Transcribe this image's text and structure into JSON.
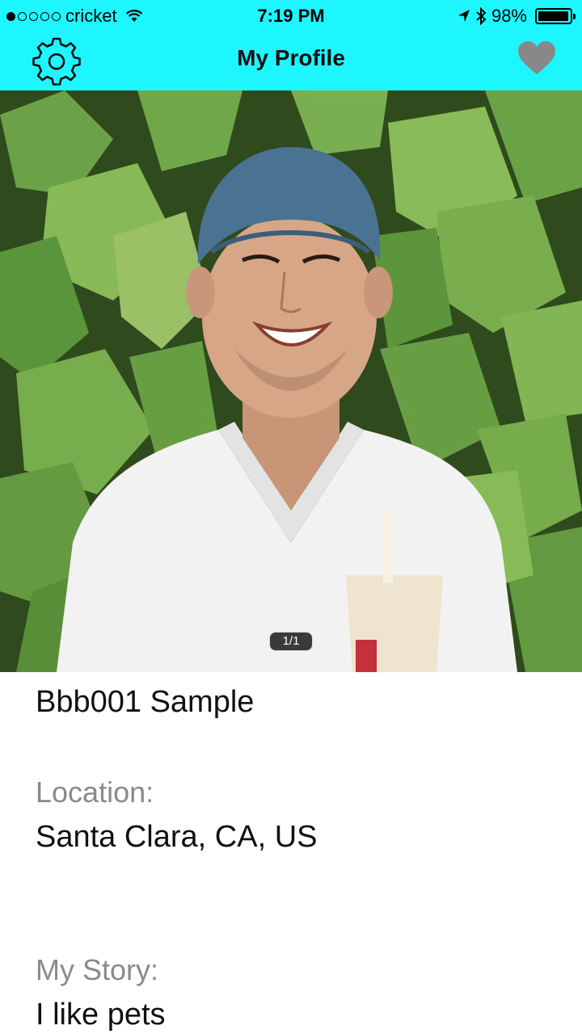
{
  "status_bar": {
    "carrier": "cricket",
    "time": "7:19 PM",
    "battery_percent": "98%",
    "battery_level": 0.98,
    "icons": [
      "signal-dots-icon",
      "wifi-icon",
      "location-arrow-icon",
      "bluetooth-icon",
      "battery-icon"
    ]
  },
  "navbar": {
    "title": "My Profile",
    "left_icon": "gear-icon",
    "right_icon": "heart-icon",
    "background_color": "#1ef6ff",
    "heart_color": "#888888"
  },
  "photo": {
    "counter": "1/1"
  },
  "profile": {
    "name": "Bbb001 Sample",
    "location_label": "Location:",
    "location_value": "Santa Clara, CA, US",
    "story_label": "My Story:",
    "story_value": "I like pets"
  }
}
